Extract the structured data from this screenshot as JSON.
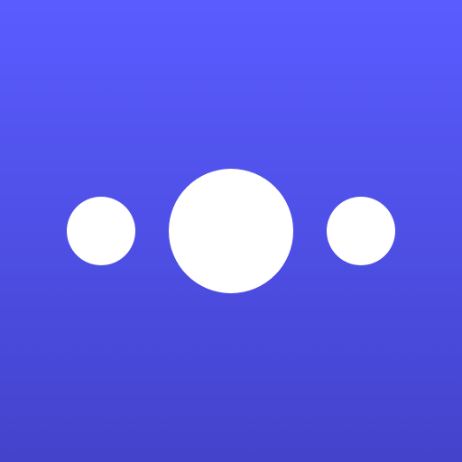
{
  "icon": {
    "name": "three-dots-logo",
    "colors": {
      "background_top": "#5a5cff",
      "background_bottom": "#4343cc",
      "dots": "#ffffff"
    },
    "dots": [
      {
        "name": "left-dot"
      },
      {
        "name": "center-dot"
      },
      {
        "name": "right-dot"
      }
    ]
  }
}
